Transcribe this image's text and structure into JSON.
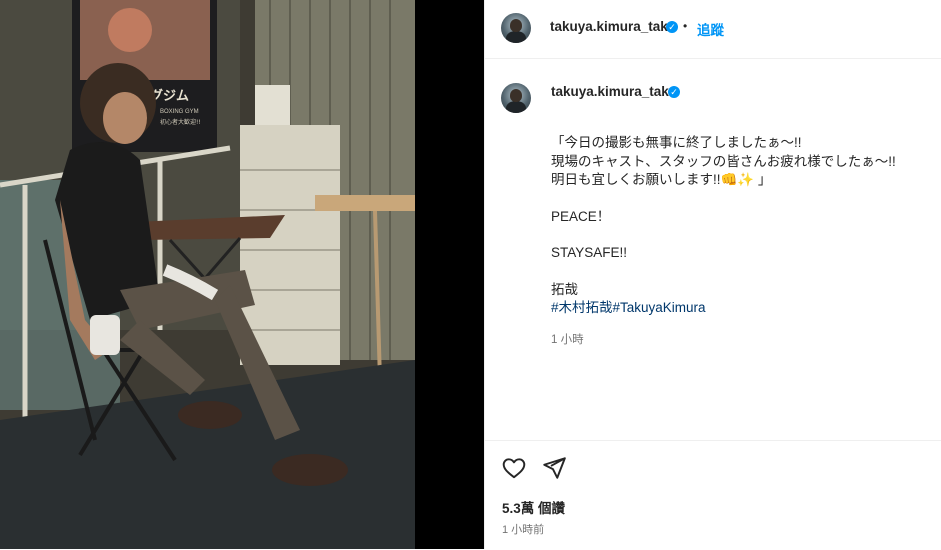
{
  "post": {
    "username": "takuya.kimura_tak",
    "verified": true,
    "separator": "•",
    "follow_label": "追蹤",
    "verified_glyph": "✓",
    "caption": {
      "line1": "「今日の撮影も無事に終了しましたぁ〜!!",
      "line2": "現場のキャスト、スタッフの皆さんお疲れ様でしたぁ〜!!",
      "line3": "明日も宜しくお願いします!!👊✨ 」",
      "line4": "PEACE！",
      "line5": "STAYSAFE!!",
      "line6": "拓哉",
      "hashtag1": "#木村拓哉",
      "hashtag2": "#TakuyaKimura"
    },
    "caption_time": "1 小時",
    "views": "5.3萬 個讚",
    "posted_time": "1 小時前"
  },
  "photo": {
    "poster_text": "グジム",
    "poster_sub": "BOXING GYM",
    "poster_sub2": "初心者大歓迎!!"
  },
  "icons": {
    "like": "heart-icon",
    "share": "send-icon",
    "verified": "verified-badge-icon"
  },
  "colors": {
    "accent": "#0095f6",
    "hashtag": "#00376b",
    "muted": "#737373"
  }
}
